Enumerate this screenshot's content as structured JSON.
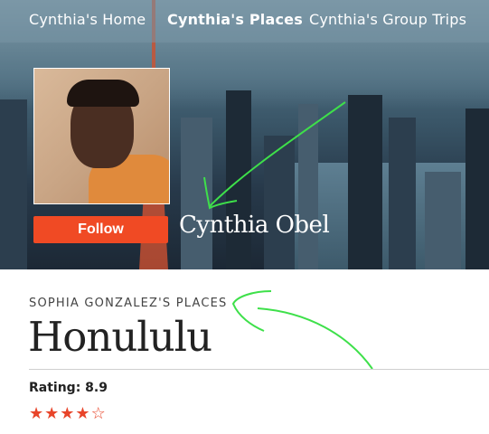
{
  "nav": {
    "items": [
      {
        "label": "Cynthia's Home",
        "active": false
      },
      {
        "label": "Cynthia's Places",
        "active": true
      },
      {
        "label": "Cynthia's Group Trips",
        "active": false
      }
    ]
  },
  "profile": {
    "name": "Cynthia Obel",
    "follow_label": "Follow"
  },
  "place": {
    "subtitle": "SOPHIA GONZALEZ'S PLACES",
    "title": "Honululu",
    "rating_text": "Rating: 8.9",
    "stars": {
      "filled": 4,
      "total": 5,
      "filled_glyph": "★",
      "empty_glyph": "☆"
    }
  },
  "colors": {
    "accent": "#f04a24",
    "annotation": "#3ee04a"
  }
}
